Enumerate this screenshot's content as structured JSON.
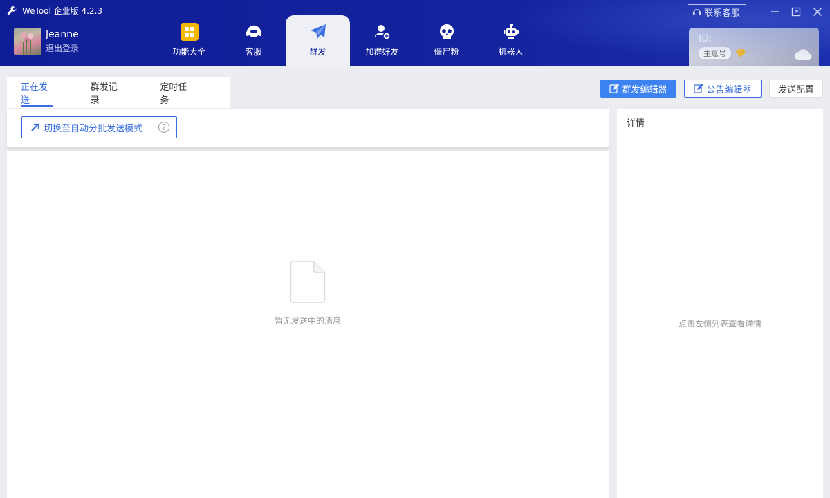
{
  "app": {
    "title": "WeTool 企业版 4.2.3"
  },
  "user": {
    "name": "Jeanne",
    "logout": "退出登录"
  },
  "nav": [
    {
      "label": "功能大全",
      "icon": "grid-icon"
    },
    {
      "label": "客服",
      "icon": "headset-icon"
    },
    {
      "label": "群发",
      "icon": "send-icon",
      "active": true
    },
    {
      "label": "加群好友",
      "icon": "add-friend-icon"
    },
    {
      "label": "僵尸粉",
      "icon": "skull-icon"
    },
    {
      "label": "机器人",
      "icon": "robot-icon"
    }
  ],
  "window": {
    "contact": "联系客服"
  },
  "account": {
    "id_label": "ID:",
    "badge": "主账号"
  },
  "tabs": [
    {
      "label": "正在发送",
      "active": true
    },
    {
      "label": "群发记录"
    },
    {
      "label": "定时任务"
    }
  ],
  "toolbar": {
    "broadcast_editor": "群发编辑器",
    "notice_editor": "公告编辑器",
    "send_config": "发送配置"
  },
  "left": {
    "switch_mode": "切换至自动分批发送模式",
    "help": "?",
    "empty": "暂无发送中的消息"
  },
  "right": {
    "title": "详情",
    "hint": "点击左侧列表查看详情"
  },
  "colors": {
    "header": "#14249f",
    "accent": "#3c82f0",
    "nav_active_bg": "#eef0f6"
  }
}
